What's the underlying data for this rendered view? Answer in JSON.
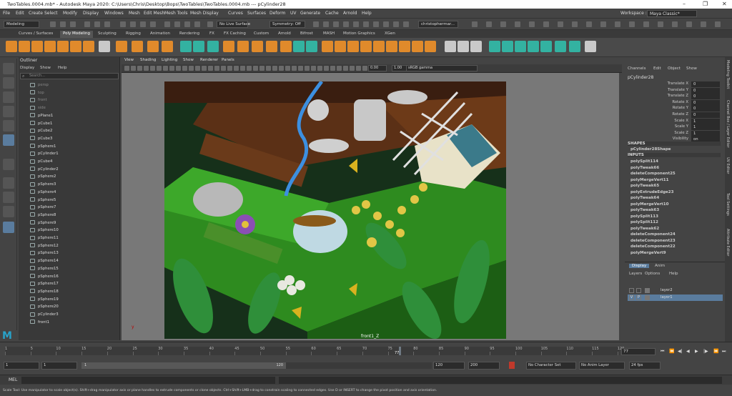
{
  "window": {
    "title": "TwoTables.0004.mb* - Autodesk Maya 2020: C:\\Users\\Chris\\Desktop\\Bops\\TwoTables\\TwoTables.0004.mb  ---  pCylinder28"
  },
  "menubar": {
    "items": [
      "File",
      "Edit",
      "Create",
      "Select",
      "Modify",
      "Display",
      "Windows",
      "Mesh",
      "Edit Mesh",
      "Mesh Tools",
      "Mesh Display",
      "Curves",
      "Surfaces",
      "Deform",
      "UV",
      "Generate",
      "Cache",
      "Arnold",
      "Help"
    ],
    "workspace_label": "Workspace :",
    "workspace_value": "Maya Classic*"
  },
  "statusline": {
    "menu_set": "Modeling",
    "live_surface": "No Live Surface",
    "symmetry": "Symmetry: Off",
    "user": "christophermar..."
  },
  "shelf_tabs": [
    "Curves / Surfaces",
    "Poly Modeling",
    "Sculpting",
    "Rigging",
    "Animation",
    "Rendering",
    "FX",
    "FX Caching",
    "Custom",
    "Arnold",
    "Bifrost",
    "MASH",
    "Motion Graphics",
    "XGen"
  ],
  "outliner": {
    "title": "Outliner",
    "menu": [
      "Display",
      "Show",
      "Help"
    ],
    "search_placeholder": "Search...",
    "items": [
      "persp",
      "top",
      "front",
      "side",
      "pPlane1",
      "pCube1",
      "pCube2",
      "pCube3",
      "pSphere1",
      "pCylinder1",
      "pCube4",
      "pCylinder2",
      "pSphere2",
      "pSphere3",
      "pSphere4",
      "pSphere5",
      "pSphere7",
      "pSphere8",
      "pSphere9",
      "pSphere10",
      "pSphere11",
      "pSphere12",
      "pSphere13",
      "pSphere14",
      "pSphere15",
      "pSphere16",
      "pSphere17",
      "pSphere18",
      "pSphere19",
      "pSphere20",
      "pCylinder3",
      "front1"
    ]
  },
  "viewport": {
    "menu": [
      "View",
      "Shading",
      "Lighting",
      "Show",
      "Renderer",
      "Panels"
    ],
    "field1": "0.00",
    "field2": "1.00",
    "color_space": "sRGB gamma",
    "camera_label": "front1_Z",
    "axis_label": "y"
  },
  "channelbox": {
    "menu": [
      "Channels",
      "Edit",
      "Object",
      "Show"
    ],
    "object": "pCylinder28",
    "attributes": [
      {
        "name": "Translate X",
        "value": "0"
      },
      {
        "name": "Translate Y",
        "value": "0"
      },
      {
        "name": "Translate Z",
        "value": "0"
      },
      {
        "name": "Rotate X",
        "value": "0"
      },
      {
        "name": "Rotate Y",
        "value": "0"
      },
      {
        "name": "Rotate Z",
        "value": "0"
      },
      {
        "name": "Scale X",
        "value": "1"
      },
      {
        "name": "Scale Y",
        "value": "1"
      },
      {
        "name": "Scale Z",
        "value": "1"
      },
      {
        "name": "Visibility",
        "value": "on"
      }
    ],
    "shapes_label": "SHAPES",
    "shape": "pCylinder28Shape",
    "inputs_label": "INPUTS",
    "inputs": [
      "polySplit114",
      "polyTweak66",
      "deleteComponent25",
      "polyMergeVert11",
      "polyTweak65",
      "polyExtrudeEdge23",
      "polyTweak64",
      "polyMergeVert10",
      "polyTweak63",
      "polySplit113",
      "polySplit112",
      "polyTweak62",
      "deleteComponent24",
      "deleteComponent23",
      "deleteComponent22",
      "polyMergeVert9"
    ]
  },
  "right_tabs": [
    "Modeling Toolkit",
    "Channel Box / Layer Editor",
    "UV Editor",
    "Tool Settings",
    "Attribute Editor"
  ],
  "layers": {
    "tabs": [
      "Display",
      "Anim"
    ],
    "menu": [
      "Layers",
      "Options",
      "Help"
    ],
    "rows": [
      {
        "v": "",
        "p": "",
        "name": "layer2"
      },
      {
        "v": "V",
        "p": "P",
        "name": "layer1"
      }
    ]
  },
  "timeline": {
    "ticks": [
      "1",
      "5",
      "10",
      "15",
      "20",
      "25",
      "30",
      "35",
      "40",
      "45",
      "50",
      "55",
      "60",
      "65",
      "70",
      "75",
      "80",
      "85",
      "90",
      "95",
      "100",
      "105",
      "110",
      "115",
      "120"
    ],
    "current_frame_label": "77",
    "current_frame_field": "77"
  },
  "range": {
    "start": "1",
    "start2": "1",
    "handle_start": "1",
    "handle_end": "120",
    "end": "120",
    "end2": "200",
    "character_set": "No Character Set",
    "anim_layer": "No Anim Layer",
    "fps": "24 fps"
  },
  "cmdline": {
    "label": "MEL"
  },
  "helpline": {
    "text": "Scale Tool: Use manipulator to scale object(s). Shift+drag manipulator axis or plane handles to extrude components or clone objects. Ctrl+Shift+LMB+drag to constrain scaling to connected edges. Use D or INSERT to change the pivot position and axis orientation."
  },
  "colors": {
    "shelf_orange": "#e08a2b",
    "selection_blue": "#5a7c9e",
    "maya_logo": "#28a2c9",
    "art_green": "#2e8b1f"
  }
}
